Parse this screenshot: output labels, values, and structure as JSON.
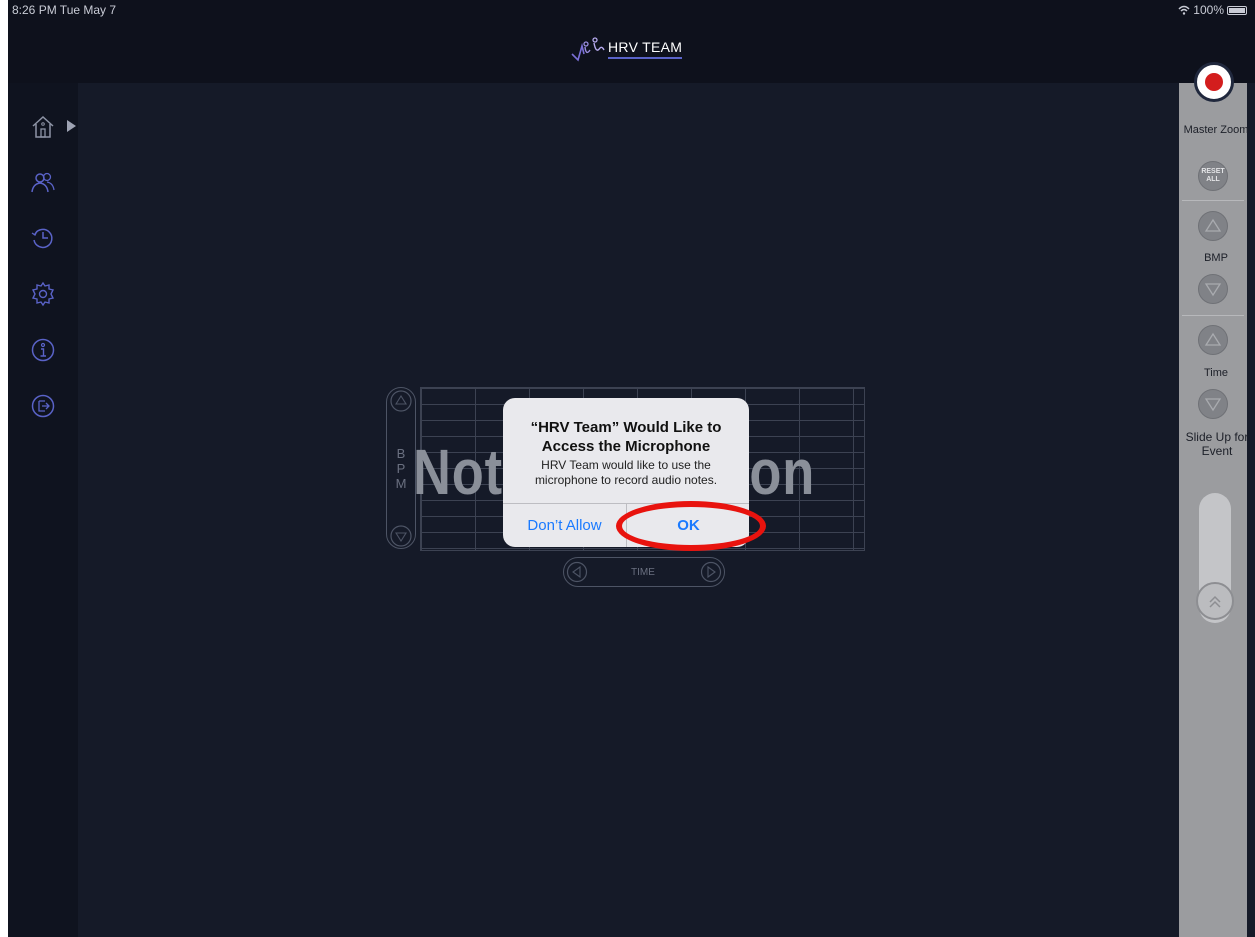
{
  "status_bar": {
    "time": "8:26 PM  Tue May 7",
    "battery": "100%"
  },
  "header": {
    "app_title": "HRV TEAM"
  },
  "sidebar": {
    "items": [
      {
        "icon": "home-icon"
      },
      {
        "icon": "users-icon"
      },
      {
        "icon": "history-icon"
      },
      {
        "icon": "settings-icon"
      },
      {
        "icon": "info-icon"
      },
      {
        "icon": "logout-icon"
      }
    ]
  },
  "right_panel": {
    "master_zoom_label": "Master Zoom",
    "reset_all_label": "RESET ALL",
    "bmp_label": "BMP",
    "time_label": "Time",
    "slide_up_label": "Slide Up for Event"
  },
  "chart": {
    "y_axis_letters": [
      "B",
      "P",
      "M"
    ],
    "x_axis_label": "TIME",
    "watermark_text": "Not Connection"
  },
  "dialog": {
    "title": "“HRV Team” Would Like to Access the Microphone",
    "message": "HRV Team would like to use the microphone to record audio notes.",
    "deny_label": "Don’t Allow",
    "ok_label": "OK"
  },
  "colors": {
    "background": "#151a28",
    "accent": "#1a7aff",
    "record": "#d31d1d",
    "highlight": "#e8130e"
  }
}
